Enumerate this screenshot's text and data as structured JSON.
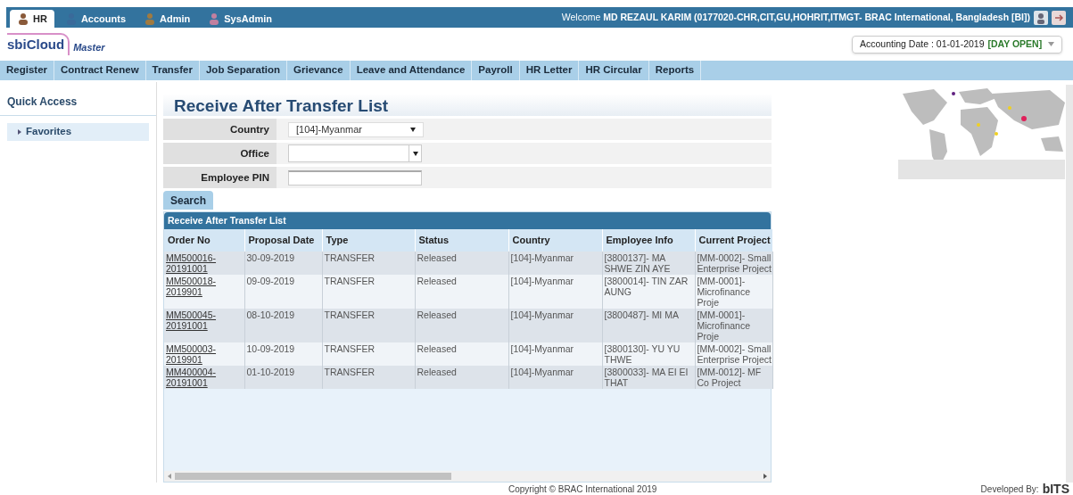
{
  "top_tabs": [
    {
      "label": "HR",
      "selected": true
    },
    {
      "label": "Accounts",
      "selected": false
    },
    {
      "label": "Admin",
      "selected": false
    },
    {
      "label": "SysAdmin",
      "selected": false
    }
  ],
  "welcome": "Welcome **MD REZAUL KARIM (0177020-CHR,CIT,GU,HOHRIT,ITMGT- BRAC International, Bangladesh [BI])**",
  "logo": {
    "name": "sbiCloud",
    "edition": "Master"
  },
  "accounting_date": {
    "label": "Accounting Date : 01-01-2019",
    "status": "[DAY OPEN]"
  },
  "menu": [
    "Register",
    "Contract Renew",
    "Transfer",
    "Job Separation",
    "Grievance",
    "Leave and Attendance",
    "Payroll",
    "HR Letter",
    "HR Circular",
    "Reports"
  ],
  "sidebar": {
    "title": "Quick Access",
    "items": [
      {
        "label": "Favorites",
        "expanded": false
      }
    ]
  },
  "page_title": "Receive After Transfer List",
  "form": [
    {
      "kind": "select",
      "label": "Country",
      "value": "[104]-Myanmar"
    },
    {
      "kind": "combo",
      "label": "Office"
    },
    {
      "kind": "text",
      "label": "Employee PIN"
    }
  ],
  "search_button": "Search",
  "table": {
    "title": "Receive After Transfer List",
    "columns": [
      "Order No",
      "Proposal Date",
      "Type",
      "Status",
      "Country",
      "Employee Info",
      "Current Project"
    ],
    "rows": [
      [
        "MM500016-20191001",
        "30-09-2019",
        "TRANSFER",
        "Released",
        "[104]-Myanmar",
        "[3800137]- MA SHWE ZIN AYE",
        "[MM-0002]- Small Enterprise Project"
      ],
      [
        "MM500018-2019901",
        "09-09-2019",
        "TRANSFER",
        "Released",
        "[104]-Myanmar",
        "[3800014]- TIN ZAR AUNG",
        "[MM-0001]- Microfinance Proje"
      ],
      [
        "MM500045-20191001",
        "08-10-2019",
        "TRANSFER",
        "Released",
        "[104]-Myanmar",
        "[3800487]- MI MA",
        "[MM-0001]- Microfinance Proje"
      ],
      [
        "MM500003-2019901",
        "10-09-2019",
        "TRANSFER",
        "Released",
        "[104]-Myanmar",
        "[3800130]- YU YU THWE",
        "[MM-0002]- Small Enterprise Project"
      ],
      [
        "MM400004-20191001",
        "01-10-2019",
        "TRANSFER",
        "Released",
        "[104]-Myanmar",
        "[3800033]- MA EI EI THAT",
        "[MM-0012]- MF Co Project"
      ]
    ]
  },
  "footer": {
    "copyright": "Copyright © BRAC International 2019",
    "developed_by": "Developed By:",
    "developer_logo": "bITS"
  }
}
